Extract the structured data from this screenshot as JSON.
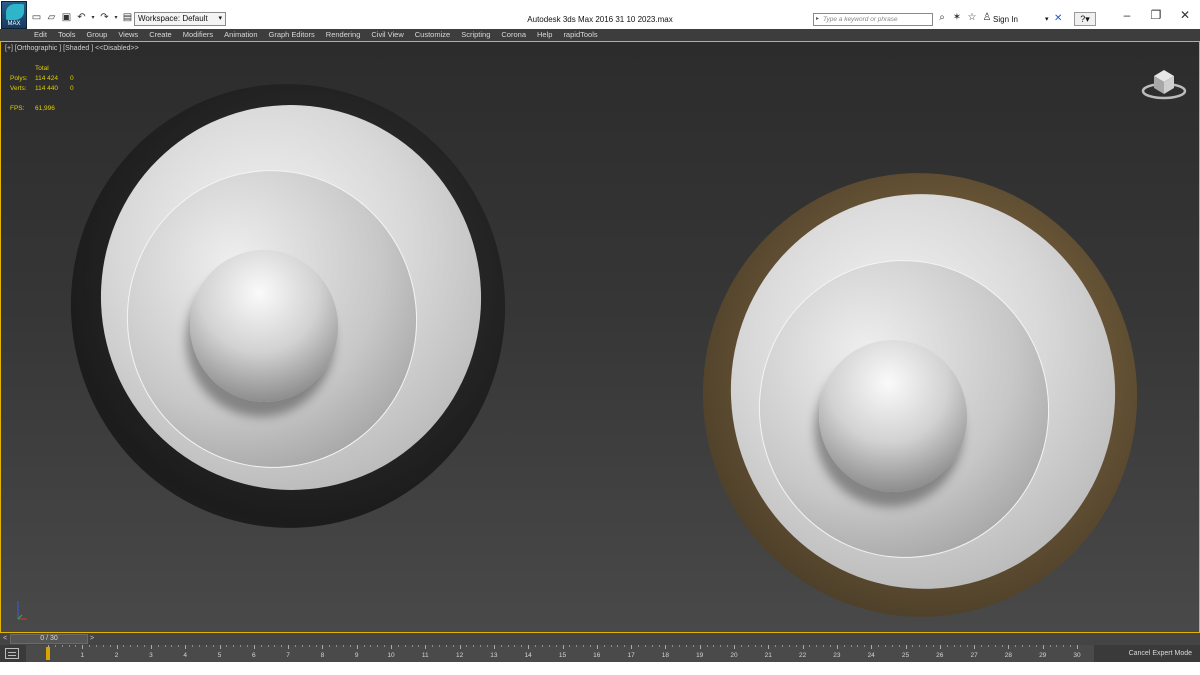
{
  "app": {
    "logo_label": "MAX",
    "title": "Autodesk 3ds Max 2016      31 10 2023.max",
    "workspace": "Workspace: Default"
  },
  "search": {
    "placeholder": "Type a keyword or phrase"
  },
  "account": {
    "signin_label": "Sign In"
  },
  "menu": [
    "Edit",
    "Tools",
    "Group",
    "Views",
    "Create",
    "Modifiers",
    "Animation",
    "Graph Editors",
    "Rendering",
    "Civil View",
    "Customize",
    "Scripting",
    "Corona",
    "Help",
    "rapidTools"
  ],
  "viewport": {
    "label": "[+] [Orthographic ] [Shaded ]  <<Disabled>>",
    "stats": {
      "header": "Total",
      "polys_label": "Polys:",
      "polys_total": "114 424",
      "polys_sel": "0",
      "verts_label": "Verts:",
      "verts_total": "114 440",
      "verts_sel": "0",
      "fps_label": "FPS:",
      "fps_value": "61,996"
    }
  },
  "timeline": {
    "frame_display": "0 / 30",
    "prev_label": "<",
    "next_label": ">",
    "ticks": [
      "0",
      "1",
      "2",
      "3",
      "4",
      "5",
      "6",
      "7",
      "8",
      "9",
      "10",
      "11",
      "12",
      "13",
      "14",
      "15",
      "16",
      "17",
      "18",
      "19",
      "20",
      "21",
      "22",
      "23",
      "24",
      "25",
      "26",
      "27",
      "28",
      "29",
      "30"
    ],
    "current_frame": 0
  },
  "status": {
    "expert_mode": "Cancel Expert Mode"
  },
  "colors": {
    "viewport_border": "#e2b400",
    "stats_text": "#e3cf00",
    "menubar_bg": "#3d3d3d",
    "ring_brown": "#6b5738"
  }
}
